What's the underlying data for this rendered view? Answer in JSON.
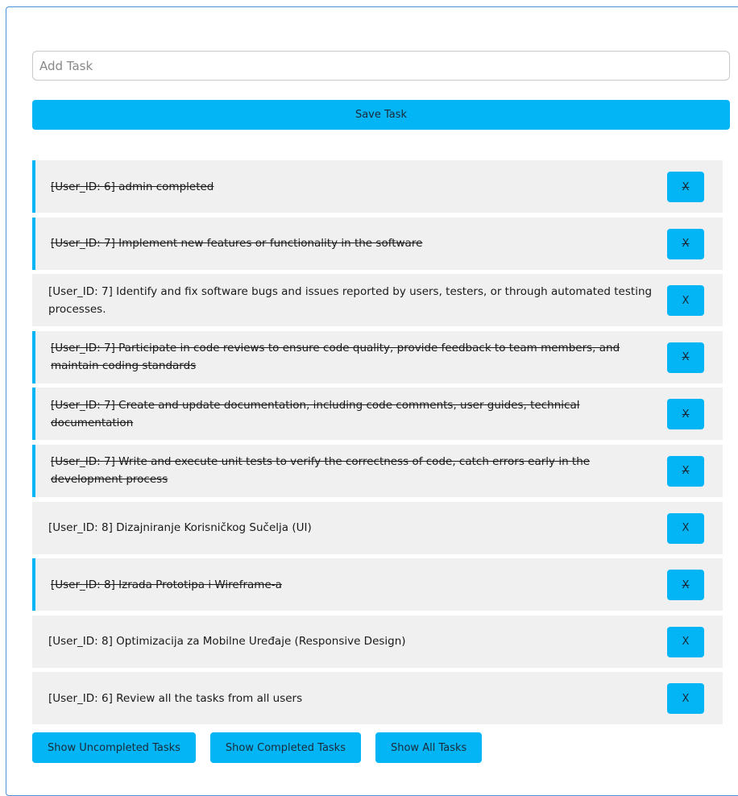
{
  "input": {
    "placeholder": "Add Task",
    "value": ""
  },
  "save_button": {
    "label": "Save Task"
  },
  "tasks": [
    {
      "text": "[User_ID: 6] admin completed",
      "completed": true,
      "delete_label": "X"
    },
    {
      "text": "[User_ID: 7] Implement new features or functionality in the software",
      "completed": true,
      "delete_label": "X"
    },
    {
      "text": "[User_ID: 7] Identify and fix software bugs and issues reported by users, testers, or through automated testing processes.",
      "completed": false,
      "delete_label": "X"
    },
    {
      "text": "[User_ID: 7] Participate in code reviews to ensure code quality, provide feedback to team members, and maintain coding standards",
      "completed": true,
      "delete_label": "X"
    },
    {
      "text": "[User_ID: 7] Create and update documentation, including code comments, user guides, technical documentation",
      "completed": true,
      "delete_label": "X"
    },
    {
      "text": "[User_ID: 7] Write and execute unit tests to verify the correctness of code, catch errors early in the development process",
      "completed": true,
      "delete_label": "X"
    },
    {
      "text": "[User_ID: 8] Dizajniranje Korisničkog Sučelja (UI)",
      "completed": false,
      "delete_label": "X"
    },
    {
      "text": "[User_ID: 8] Izrada Prototipa i Wireframe-a",
      "completed": true,
      "delete_label": "X"
    },
    {
      "text": "[User_ID: 8] Optimizacija za Mobilne Uređaje (Responsive Design)",
      "completed": false,
      "delete_label": "X"
    },
    {
      "text": "[User_ID: 6] Review all the tasks from all users",
      "completed": false,
      "delete_label": "X"
    }
  ],
  "filters": {
    "uncompleted_label": "Show Uncompleted Tasks",
    "completed_label": "Show Completed Tasks",
    "all_label": "Show All Tasks"
  },
  "colors": {
    "accent": "#03b5f5",
    "row_background": "#f0f0f0",
    "card_border": "#4a90d9"
  }
}
